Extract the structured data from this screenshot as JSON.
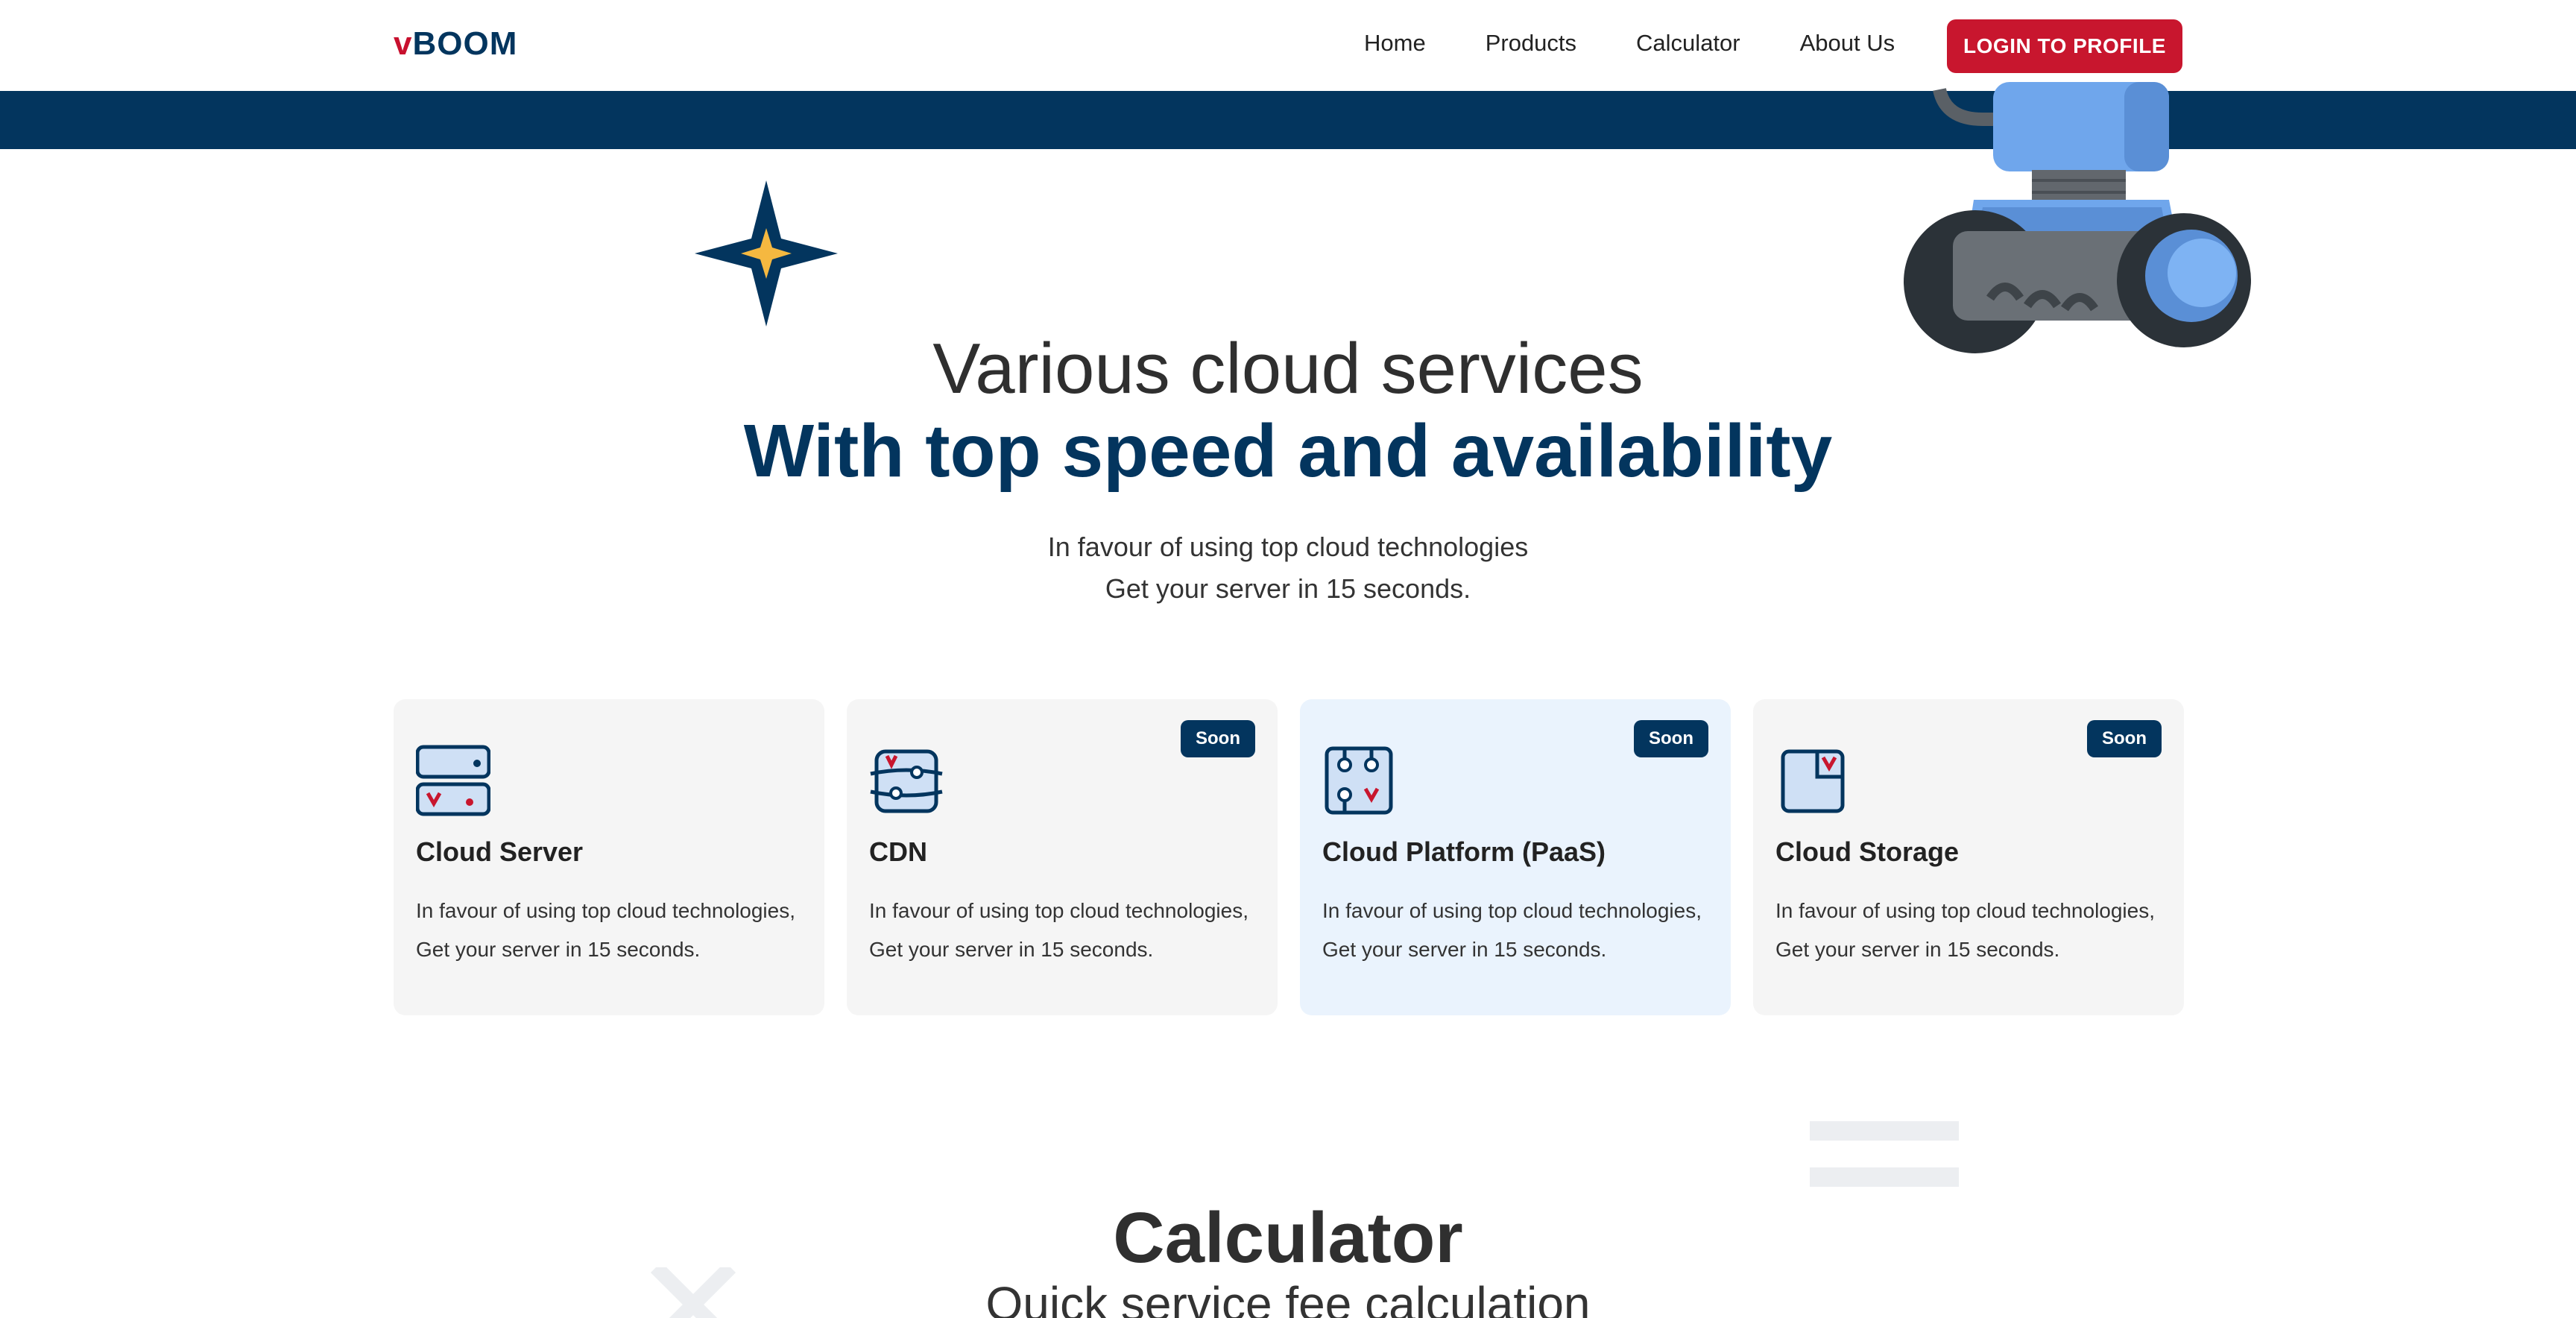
{
  "header": {
    "logo_v": "v",
    "logo_rest": "BOOM",
    "nav": [
      {
        "label": "Home"
      },
      {
        "label": "Products"
      },
      {
        "label": "Calculator"
      },
      {
        "label": "About Us"
      }
    ],
    "login_label": "LOGIN TO PROFILE"
  },
  "hero": {
    "title": "Various cloud services",
    "subtitle": "With top speed and availability",
    "desc_line1": "In favour of using top cloud technologies",
    "desc_line2": "Get your server in 15 seconds."
  },
  "cards": [
    {
      "title": "Cloud Server",
      "badge": "",
      "desc_line1": "In favour of using top cloud technologies,",
      "desc_line2": "Get your server in 15 seconds."
    },
    {
      "title": "CDN",
      "badge": "Soon",
      "desc_line1": "In favour of using top cloud technologies,",
      "desc_line2": "Get your server in 15 seconds."
    },
    {
      "title": "Cloud Platform (PaaS)",
      "badge": "Soon",
      "desc_line1": "In favour of using top cloud technologies,",
      "desc_line2": "Get your server in 15 seconds."
    },
    {
      "title": "Cloud Storage",
      "badge": "Soon",
      "desc_line1": "In favour of using top cloud technologies,",
      "desc_line2": "Get your server in 15 seconds."
    }
  ],
  "calculator": {
    "title": "Calculator",
    "subtitle": "Quick service fee calculation"
  },
  "colors": {
    "brand_navy": "#03355e",
    "brand_red": "#c8162e",
    "card_bg": "#f5f5f5",
    "card_active_bg": "#eaf3fd"
  }
}
